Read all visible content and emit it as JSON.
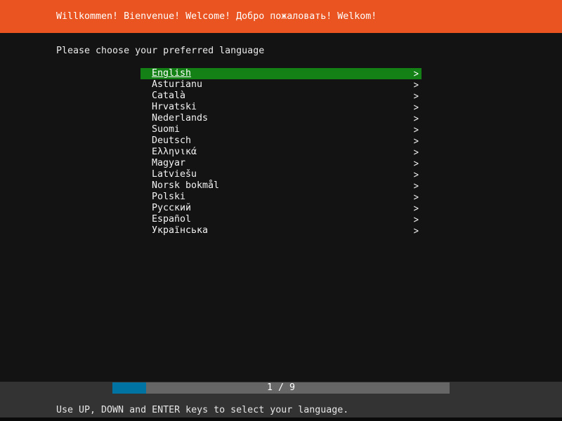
{
  "colors": {
    "header_bg": "#e95420",
    "body_bg": "#131313",
    "footer_bg": "#333333",
    "selection_bg": "#148117",
    "progress_fill": "#0073a2",
    "progress_track": "#666666",
    "text": "#ffffff"
  },
  "header": {
    "title": "Willkommen! Bienvenue! Welcome! Добро пожаловать! Welkom!"
  },
  "main": {
    "prompt": "Please choose your preferred language",
    "chevron_glyph": ">",
    "selected_index": 0,
    "selected_language": "English",
    "languages": [
      "English",
      "Asturianu",
      "Català",
      "Hrvatski",
      "Nederlands",
      "Suomi",
      "Deutsch",
      "Ελληνικά",
      "Magyar",
      "Latviešu",
      "Norsk bokmål",
      "Polski",
      "Русский",
      "Español",
      "Українська"
    ]
  },
  "progress": {
    "label": "1 / 9",
    "current_step": 1,
    "total_steps": 9
  },
  "footer": {
    "help": "Use UP, DOWN and ENTER keys to select your language."
  }
}
